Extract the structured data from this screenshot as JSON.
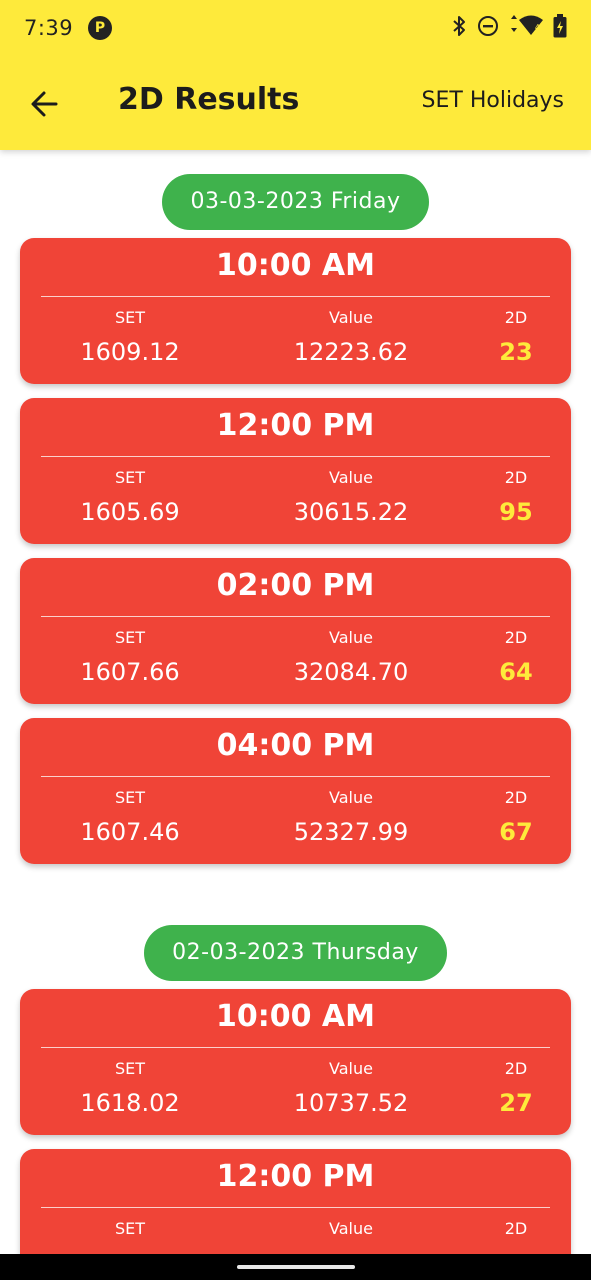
{
  "status_bar": {
    "time": "7:39",
    "app_icon_glyph": "P",
    "icons": [
      "bluetooth-icon",
      "do-not-disturb-icon",
      "wifi-icon",
      "battery-icon"
    ]
  },
  "app_bar": {
    "back_icon": "arrow-left-icon",
    "title": "2D Results",
    "action_label": "SET Holidays"
  },
  "colors": {
    "app_bar_yellow": "#FEEA3B",
    "card_red": "#F04437",
    "date_pill_green": "#3FB24C",
    "highlight_2d": "#FEEA3B"
  },
  "labels": {
    "set": "SET",
    "value": "Value",
    "two_d": "2D"
  },
  "groups": [
    {
      "date": "03-03-2023 Friday",
      "results": [
        {
          "time": "10:00 AM",
          "set": "1609.12",
          "value": "12223.62",
          "two_d": "23"
        },
        {
          "time": "12:00 PM",
          "set": "1605.69",
          "value": "30615.22",
          "two_d": "95"
        },
        {
          "time": "02:00 PM",
          "set": "1607.66",
          "value": "32084.70",
          "two_d": "64"
        },
        {
          "time": "04:00 PM",
          "set": "1607.46",
          "value": "52327.99",
          "two_d": "67"
        }
      ]
    },
    {
      "date": "02-03-2023 Thursday",
      "results": [
        {
          "time": "10:00 AM",
          "set": "1618.02",
          "value": "10737.52",
          "two_d": "27"
        },
        {
          "time": "12:00 PM",
          "set": "",
          "value": "",
          "two_d": ""
        }
      ]
    }
  ]
}
